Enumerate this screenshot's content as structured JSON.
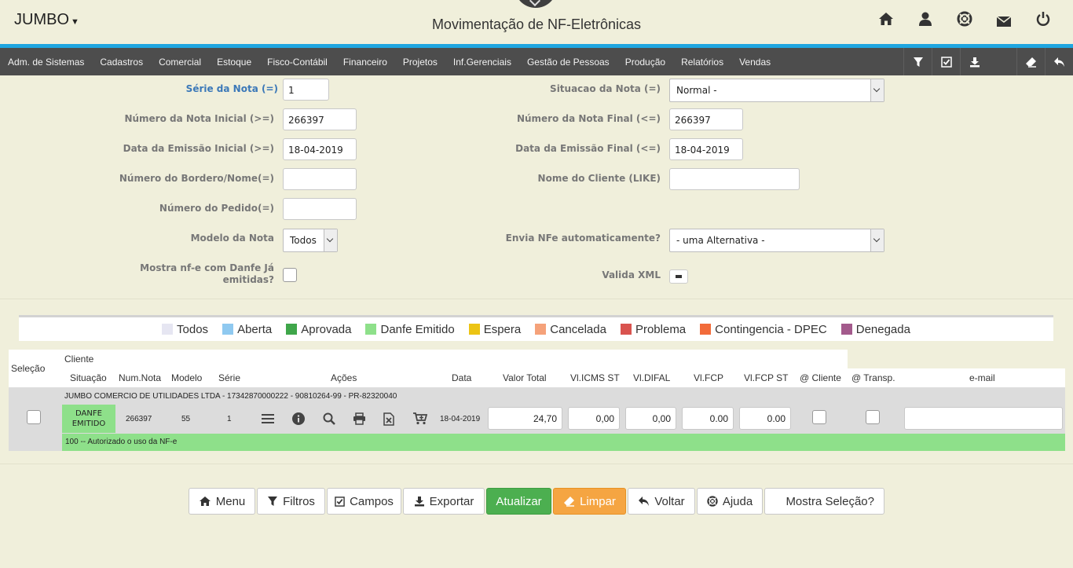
{
  "header": {
    "brand": "JUMBO",
    "title": "Movimentação de NF-Eletrônicas"
  },
  "nav": {
    "items": [
      "Adm. de Sistemas",
      "Cadastros",
      "Comercial",
      "Estoque",
      "Fisco-Contábil",
      "Financeiro",
      "Projetos",
      "Inf.Gerenciais",
      "Gestão de Pessoas",
      "Produção",
      "Relatórios",
      "Vendas"
    ]
  },
  "form": {
    "serie_label": "Série da Nota (=)",
    "serie_value": "1",
    "situacao_label": "Situacao da Nota (=)",
    "situacao_value": "Normal -",
    "num_inicial_label": "Número da Nota Inicial (>=)",
    "num_inicial_value": "266397",
    "num_final_label": "Número da Nota Final (<=)",
    "num_final_value": "266397",
    "data_inicial_label": "Data da Emissão Inicial (>=)",
    "data_inicial_value": "18-04-2019",
    "data_final_label": "Data da Emissão Final (<=)",
    "data_final_value": "18-04-2019",
    "bordero_label": "Número do Bordero/Nome(=)",
    "bordero_value": "",
    "cliente_label": "Nome do Cliente (LIKE)",
    "cliente_value": "",
    "pedido_label": "Número do Pedido(=)",
    "pedido_value": "",
    "modelo_label": "Modelo da Nota",
    "modelo_value": "Todos",
    "envia_label": "Envia NFe automaticamente?",
    "envia_value": "- uma Alternativa -",
    "mostra_label_1": "Mostra nf-e com Danfe Já",
    "mostra_label_2": "emitidas?",
    "valida_label": "Valida XML"
  },
  "legend": [
    {
      "label": "Todos",
      "color": "#e6e6f2"
    },
    {
      "label": "Aberta",
      "color": "#8fc9f0"
    },
    {
      "label": "Aprovada",
      "color": "#3fa64a"
    },
    {
      "label": "Danfe Emitido",
      "color": "#8ee08a"
    },
    {
      "label": "Espera",
      "color": "#ecc414"
    },
    {
      "label": "Cancelada",
      "color": "#f5a27a"
    },
    {
      "label": "Problema",
      "color": "#d9534f"
    },
    {
      "label": "Contingencia - DPEC",
      "color": "#f26b3a"
    },
    {
      "label": "Denegada",
      "color": "#a35a8c"
    }
  ],
  "table": {
    "headers": {
      "selecao": "Seleção",
      "cliente": "Cliente",
      "situacao": "Situação",
      "num_nota": "Num.Nota",
      "modelo": "Modelo",
      "serie": "Série",
      "acoes": "Ações",
      "data": "Data",
      "valor_total": "Valor Total",
      "vl_icms_st": "Vl.ICMS ST",
      "vl_difal": "Vl.DIFAL",
      "vl_fcp": "Vl.FCP",
      "vl_fcp_st": "Vl.FCP ST",
      "at_cliente": "@ Cliente",
      "at_transp": "@ Transp.",
      "email": "e-mail"
    },
    "row": {
      "cliente": "JUMBO COMERCIO DE UTILIDADES LTDA - 17342870000222 - 90810264-99 - PR-82320040",
      "situacao_1": "DANFE",
      "situacao_2": "EMITIDO",
      "num_nota": "266397",
      "modelo": "55",
      "serie": "1",
      "data": "18-04-2019",
      "valor_total": "24,70",
      "vl_icms_st": "0,00",
      "vl_difal": "0,00",
      "vl_fcp": "0.00",
      "vl_fcp_st": "0.00",
      "email": "",
      "status_msg": "100 -- Autorizado o uso da NF-e"
    }
  },
  "buttons": {
    "menu": "Menu",
    "filtros": "Filtros",
    "campos": "Campos",
    "exportar": "Exportar",
    "atualizar": "Atualizar",
    "limpar": "Limpar",
    "voltar": "Voltar",
    "ajuda": "Ajuda",
    "mostra_selecao": "Mostra Seleção?"
  }
}
